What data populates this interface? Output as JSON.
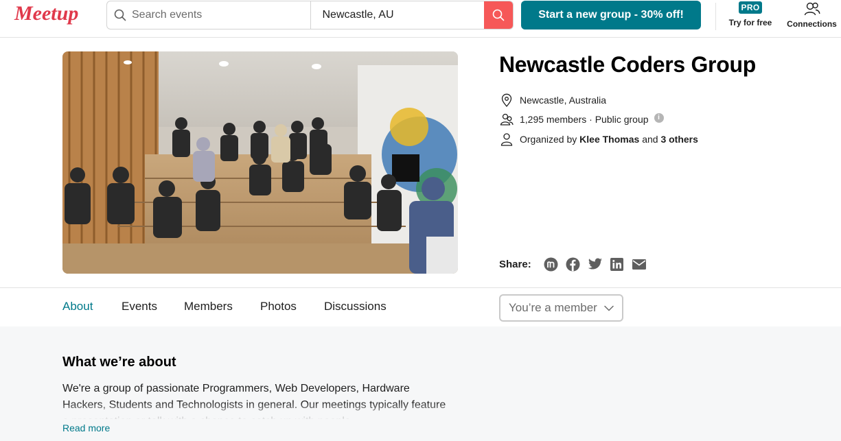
{
  "header": {
    "logo_text": "Meetup",
    "search_placeholder": "Search events",
    "location_value": "Newcastle, AU",
    "cta_label": "Start a new group - 30% off!",
    "pro_badge": "PRO",
    "pro_label": "Try for free",
    "connections_label": "Connections"
  },
  "group": {
    "name": "Newcastle Coders Group",
    "location": "Newcastle, Australia",
    "members": "1,295 members · Public group",
    "organized_prefix": "Organized by",
    "organizer": "Klee Thomas",
    "organized_joiner": "and",
    "others": "3 others",
    "share_label": "Share:"
  },
  "tabs": [
    {
      "label": "About",
      "active": true
    },
    {
      "label": "Events",
      "active": false
    },
    {
      "label": "Members",
      "active": false
    },
    {
      "label": "Photos",
      "active": false
    },
    {
      "label": "Discussions",
      "active": false
    }
  ],
  "membership_button": "You’re a member",
  "about": {
    "title": "What we’re about",
    "text": "We're a group of passionate Programmers, Web Developers, Hardware Hackers, Students and Technologists in general. Our meetings typically feature a presentation or talk with a chance to catch up with people",
    "read_more": "Read more"
  },
  "colors": {
    "brand_red": "#f65858",
    "teal": "#00798a",
    "logo": "#e0394b"
  }
}
